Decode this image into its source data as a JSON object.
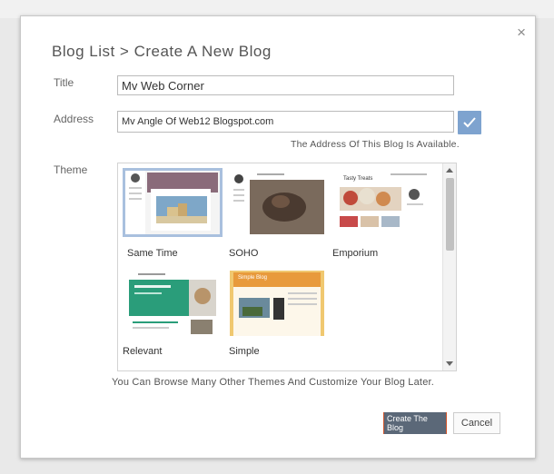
{
  "dialog": {
    "heading": "Blog List > Create A New Blog",
    "close_glyph": "×"
  },
  "form": {
    "title_label": "Title",
    "title_value": "Mv Web Corner",
    "address_label": "Address",
    "address_value": "Mv Angle Of Web12 Blogspot.com",
    "availability_note": "The Address Of This Blog Is Available.",
    "theme_label": "Theme"
  },
  "themes": [
    {
      "name": "Same Time",
      "selected": true
    },
    {
      "name": "SOHO",
      "selected": false
    },
    {
      "name": "Emporium",
      "selected": false
    },
    {
      "name": "Relevant",
      "selected": false
    },
    {
      "name": "Simple",
      "selected": false
    }
  ],
  "thumb_text": {
    "tasty_treats": "Tasty Treats",
    "simple_blog": "Simple Blog"
  },
  "browse_note": "You Can Browse Many Other Themes And Customize Your Blog Later.",
  "buttons": {
    "create": "Create The Blog",
    "cancel": "Cancel"
  },
  "colors": {
    "accent": "#e8663a",
    "check": "#7ea3cf",
    "selected_outline": "#a9c0de"
  }
}
